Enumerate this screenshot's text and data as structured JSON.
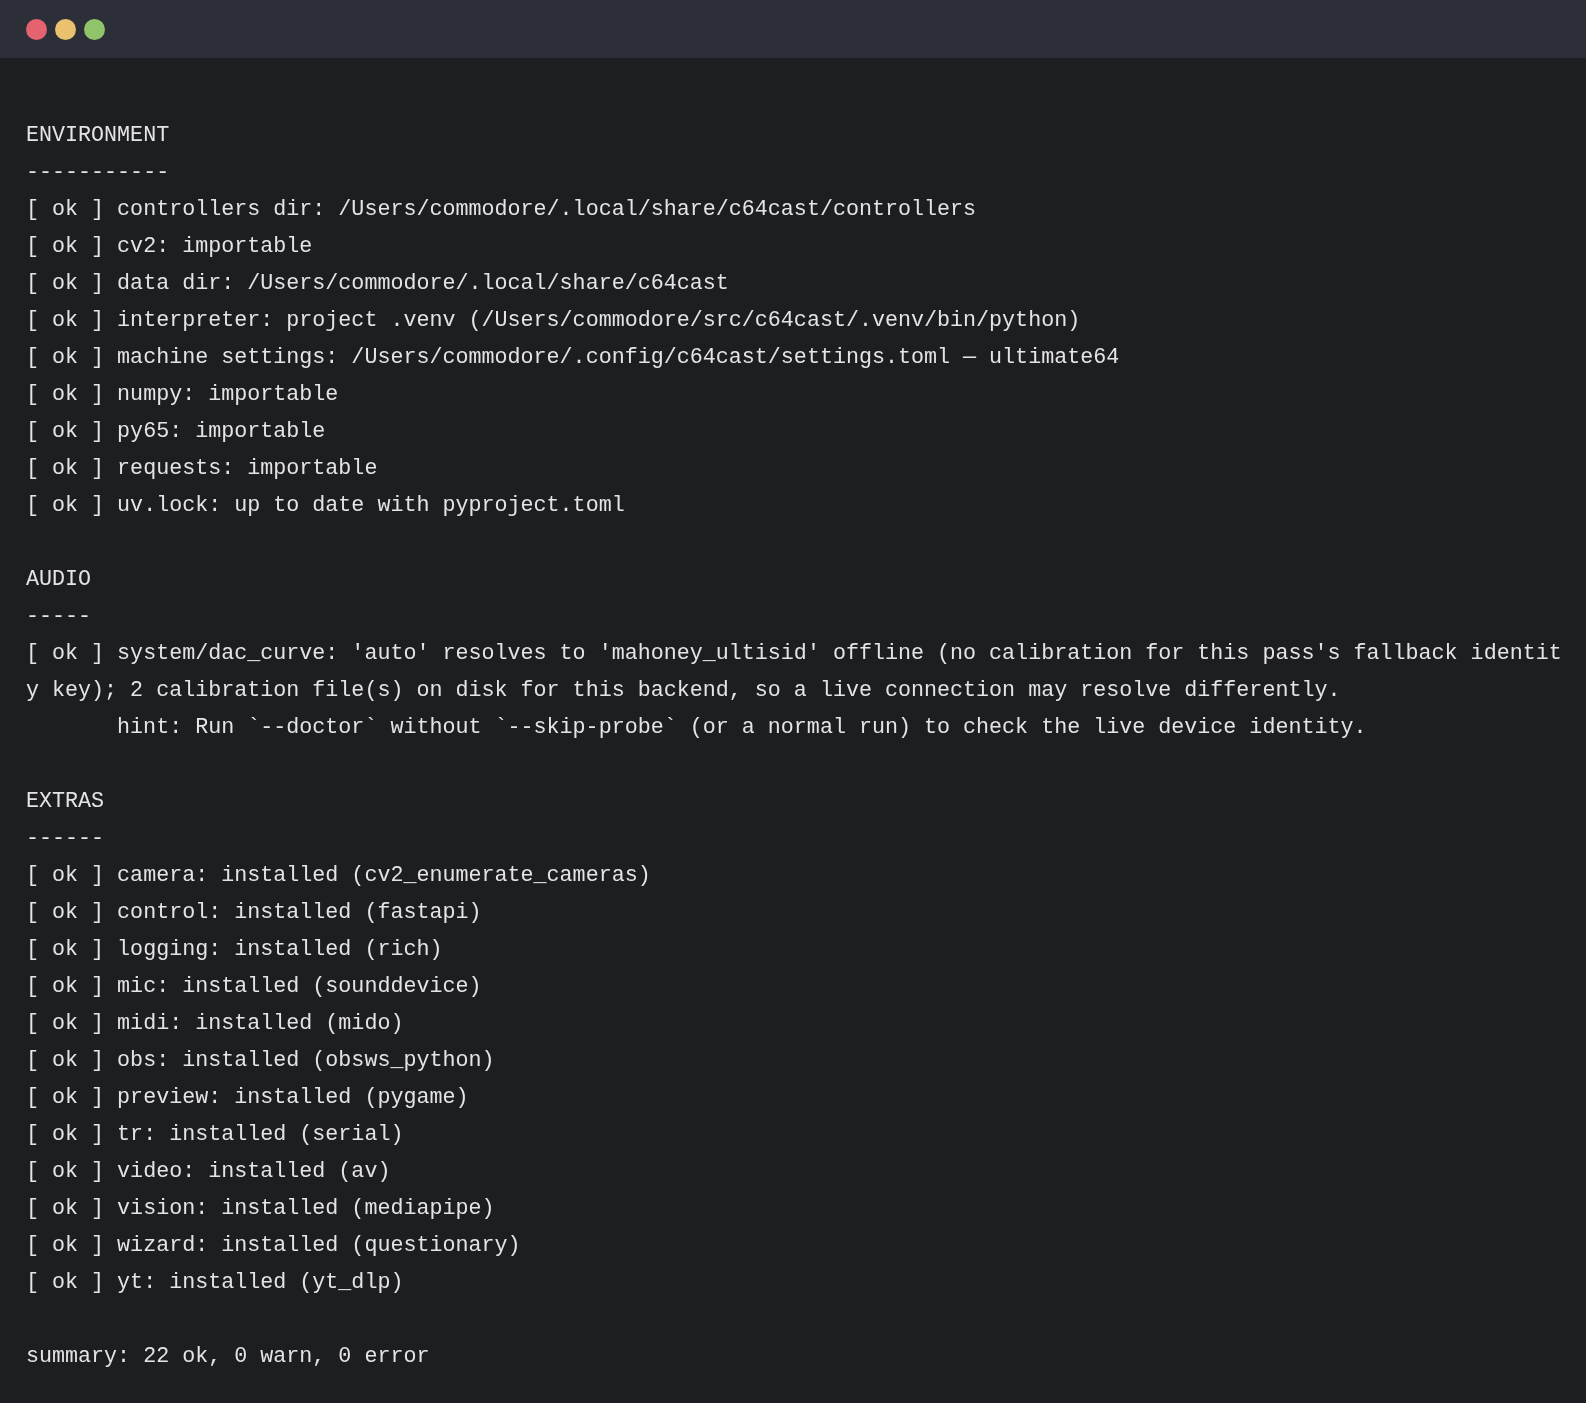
{
  "window": {
    "controls": [
      {
        "color": "#e5636f"
      },
      {
        "color": "#e9c16f"
      },
      {
        "color": "#8fc46a"
      }
    ]
  },
  "sections": [
    {
      "title": "ENVIRONMENT",
      "rule": "-----------",
      "lines": [
        {
          "kind": "check",
          "text": "[ ok ] controllers dir: /Users/commodore/.local/share/c64cast/controllers"
        },
        {
          "kind": "check",
          "text": "[ ok ] cv2: importable"
        },
        {
          "kind": "check",
          "text": "[ ok ] data dir: /Users/commodore/.local/share/c64cast"
        },
        {
          "kind": "check",
          "text": "[ ok ] interpreter: project .venv (/Users/commodore/src/c64cast/.venv/bin/python)"
        },
        {
          "kind": "check",
          "text": "[ ok ] machine settings: /Users/commodore/.config/c64cast/settings.toml — ultimate64"
        },
        {
          "kind": "check",
          "text": "[ ok ] numpy: importable"
        },
        {
          "kind": "check",
          "text": "[ ok ] py65: importable"
        },
        {
          "kind": "check",
          "text": "[ ok ] requests: importable"
        },
        {
          "kind": "check",
          "text": "[ ok ] uv.lock: up to date with pyproject.toml"
        }
      ]
    },
    {
      "title": "AUDIO",
      "rule": "-----",
      "lines": [
        {
          "kind": "check",
          "text": "[ ok ] system/dac_curve: 'auto' resolves to 'mahoney_ultisid' offline (no calibration for this pass's fallback identit"
        },
        {
          "kind": "continued",
          "text": "y key); 2 calibration file(s) on disk for this backend, so a live connection may resolve differently."
        },
        {
          "kind": "hint",
          "text": "hint: Run `--doctor` without `--skip-probe` (or a normal run) to check the live device identity."
        }
      ]
    },
    {
      "title": "EXTRAS",
      "rule": "------",
      "lines": [
        {
          "kind": "check",
          "text": "[ ok ] camera: installed (cv2_enumerate_cameras)"
        },
        {
          "kind": "check",
          "text": "[ ok ] control: installed (fastapi)"
        },
        {
          "kind": "check",
          "text": "[ ok ] logging: installed (rich)"
        },
        {
          "kind": "check",
          "text": "[ ok ] mic: installed (sounddevice)"
        },
        {
          "kind": "check",
          "text": "[ ok ] midi: installed (mido)"
        },
        {
          "kind": "check",
          "text": "[ ok ] obs: installed (obsws_python)"
        },
        {
          "kind": "check",
          "text": "[ ok ] preview: installed (pygame)"
        },
        {
          "kind": "check",
          "text": "[ ok ] tr: installed (serial)"
        },
        {
          "kind": "check",
          "text": "[ ok ] video: installed (av)"
        },
        {
          "kind": "check",
          "text": "[ ok ] vision: installed (mediapipe)"
        },
        {
          "kind": "check",
          "text": "[ ok ] wizard: installed (questionary)"
        },
        {
          "kind": "check",
          "text": "[ ok ] yt: installed (yt_dlp)"
        }
      ]
    }
  ],
  "summary": "summary: 22 ok, 0 warn, 0 error"
}
